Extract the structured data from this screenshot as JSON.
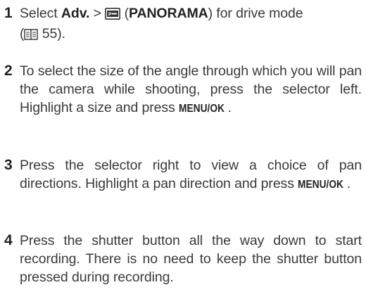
{
  "steps": [
    {
      "number": "1",
      "text_a": "Select ",
      "bold_a": "Adv.",
      "text_b": " > ",
      "icon": "panorama-mode-icon",
      "text_c": " (",
      "bold_b": "PANORAMA",
      "text_d": ") for drive mode",
      "text_e": "(",
      "ref_icon": "book-reference-icon",
      "ref_page": " 55)."
    },
    {
      "number": "2",
      "text": "To select the size of the angle through which you will pan the camera while shooting, press the selector left.  Highlight a size and press ",
      "key": "MENU/OK",
      "end": "."
    },
    {
      "number": "3",
      "text": "Press the selector right to view a choice of pan directions. Highlight a pan direction and press ",
      "key": "MENU/OK",
      "end": "."
    },
    {
      "number": "4",
      "text": "Press the shutter button all the way down to start recording.  There is no need to keep the shutter button pressed during recording."
    }
  ]
}
